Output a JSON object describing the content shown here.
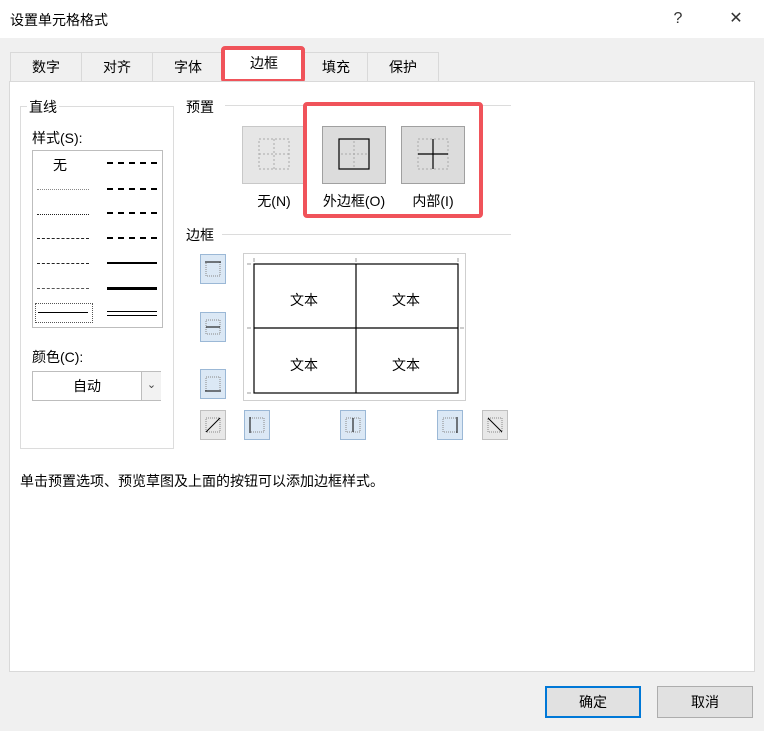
{
  "dialog": {
    "title": "设置单元格格式",
    "help_label": "?",
    "close_label": "✕"
  },
  "tabs": [
    {
      "label": "数字"
    },
    {
      "label": "对齐"
    },
    {
      "label": "字体"
    },
    {
      "label": "边框",
      "active": true
    },
    {
      "label": "填充"
    },
    {
      "label": "保护"
    }
  ],
  "line": {
    "group_label": "直线",
    "style_label": "样式(S):",
    "none_label": "无",
    "color_label": "颜色(C):",
    "color_value": "自动"
  },
  "presets": {
    "section_label": "预置",
    "items": [
      {
        "label": "无(N)"
      },
      {
        "label": "外边框(O)"
      },
      {
        "label": "内部(I)"
      }
    ]
  },
  "border": {
    "section_label": "边框",
    "cell_text": "文本"
  },
  "hint": "单击预置选项、预览草图及上面的按钮可以添加边框样式。",
  "buttons": {
    "ok": "确定",
    "cancel": "取消"
  },
  "colors": {
    "highlight": "#f0535a",
    "primary_border": "#0078d7",
    "toggle_fill": "#dbe8f5"
  }
}
